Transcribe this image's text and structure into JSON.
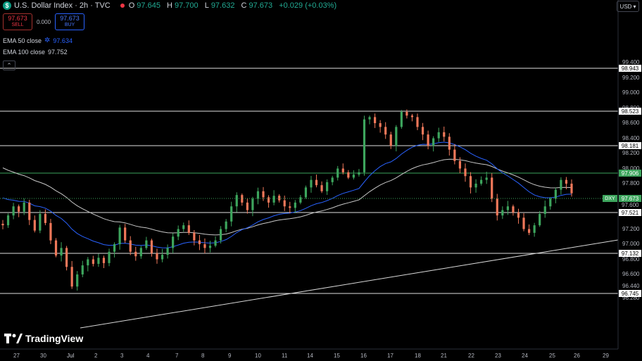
{
  "header": {
    "symbol_icon": "$",
    "title": "U.S. Dollar Index · 2h · TVC",
    "ohlc": [
      {
        "k": "O",
        "v": "97.645"
      },
      {
        "k": "H",
        "v": "97.700"
      },
      {
        "k": "L",
        "v": "97.632"
      },
      {
        "k": "C",
        "v": "97.673"
      }
    ],
    "change": "+0.029 (+0.03%)"
  },
  "trade": {
    "sell_price": "97.673",
    "sell_label": "SELL",
    "spread": "0.000",
    "buy_price": "97.673",
    "buy_label": "BUY"
  },
  "indicators": [
    {
      "name": "EMA 50 close",
      "value": "97.634",
      "color": "#2962ff"
    },
    {
      "name": "EMA 100 close",
      "value": "97.752",
      "color": "#d1d4dc"
    }
  ],
  "currency": "USD",
  "current": {
    "symbol": "DXY",
    "price": "97.673",
    "second": "97.600"
  },
  "levels": [
    "98.943",
    "98.523",
    "98.181",
    "97.906",
    "97.521",
    "97.132",
    "96.745"
  ],
  "logo_text": "TradingView",
  "chart_data": {
    "type": "candlestick",
    "y_ticks": [
      "99.400",
      "99.200",
      "99.000",
      "98.800",
      "98.600",
      "98.400",
      "98.200",
      "98.000",
      "97.800",
      "97.400",
      "97.200",
      "97.000",
      "96.800",
      "96.600",
      "96.440",
      "96.280"
    ],
    "x_ticks": [
      "27",
      "30",
      "Jul",
      "2",
      "3",
      "4",
      "7",
      "8",
      "9",
      "10",
      "11",
      "14",
      "15",
      "16",
      "17",
      "18",
      "21",
      "22",
      "23",
      "24",
      "25",
      "26",
      "29"
    ],
    "close_series": [
      97.25,
      97.38,
      97.5,
      97.43,
      97.55,
      97.32,
      97.18,
      97.4,
      97.28,
      97.05,
      96.85,
      96.95,
      96.7,
      96.44,
      96.6,
      96.72,
      96.8,
      96.74,
      96.82,
      96.75,
      96.9,
      97.0,
      97.22,
      97.05,
      96.9,
      96.84,
      96.95,
      97.05,
      96.88,
      96.8,
      96.86,
      96.95,
      97.1,
      97.2,
      97.25,
      97.15,
      97.05,
      97.0,
      96.95,
      96.98,
      97.05,
      97.2,
      97.3,
      97.5,
      97.65,
      97.55,
      97.45,
      97.6,
      97.7,
      97.62,
      97.55,
      97.64,
      97.58,
      97.5,
      97.48,
      97.55,
      97.62,
      97.75,
      97.85,
      97.78,
      97.7,
      97.82,
      97.88,
      98.0,
      97.95,
      97.88,
      97.92,
      97.95,
      98.65,
      98.68,
      98.6,
      98.55,
      98.45,
      98.3,
      98.55,
      98.75,
      98.7,
      98.68,
      98.55,
      98.45,
      98.3,
      98.4,
      98.48,
      98.42,
      98.25,
      98.1,
      98.0,
      97.9,
      97.75,
      97.8,
      97.85,
      97.88,
      97.6,
      97.38,
      97.45,
      97.5,
      97.42,
      97.35,
      97.2,
      97.15,
      97.25,
      97.4,
      97.5,
      97.6,
      97.72,
      97.85,
      97.8,
      97.673
    ]
  }
}
